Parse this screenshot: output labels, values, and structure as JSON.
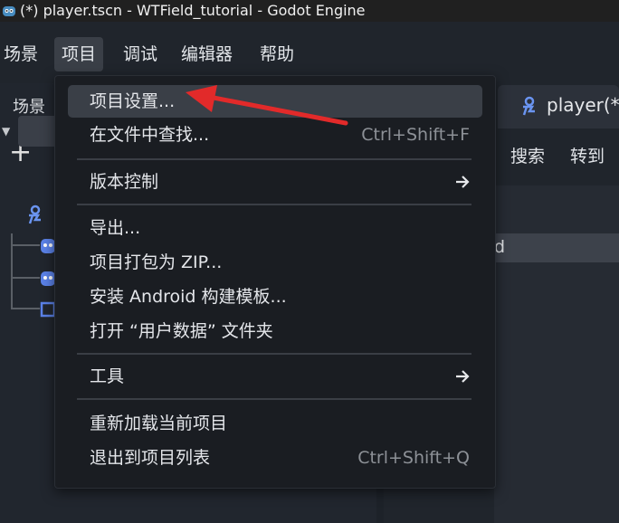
{
  "window": {
    "title": "(*) player.tscn - WTField_tutorial - Godot Engine"
  },
  "menubar": {
    "items": [
      "场景",
      "项目",
      "调试",
      "编辑器",
      "帮助"
    ]
  },
  "scene_dock": {
    "tab_label": "场景",
    "add_symbol": "+"
  },
  "editor": {
    "tab_label": "player(*",
    "search_label": "搜索",
    "goto_label": "转到",
    "script_line_text": "d"
  },
  "dropdown": {
    "items": [
      {
        "label": "项目设置...",
        "shortcut": ""
      },
      {
        "label": "在文件中查找...",
        "shortcut": "Ctrl+Shift+F"
      },
      {
        "label": "版本控制",
        "shortcut": ""
      },
      {
        "label": "导出...",
        "shortcut": ""
      },
      {
        "label": "项目打包为 ZIP...",
        "shortcut": ""
      },
      {
        "label": "安装 Android 构建模板...",
        "shortcut": ""
      },
      {
        "label": "打开 “用户数据” 文件夹",
        "shortcut": ""
      },
      {
        "label": "工具",
        "shortcut": ""
      },
      {
        "label": "重新加载当前项目",
        "shortcut": ""
      },
      {
        "label": "退出到项目列表",
        "shortcut": "Ctrl+Shift+Q"
      }
    ]
  },
  "colors": {
    "accent_red": "#e22a2a",
    "godot_blue": "#478cbf",
    "node_blue": "#5b82e8"
  }
}
